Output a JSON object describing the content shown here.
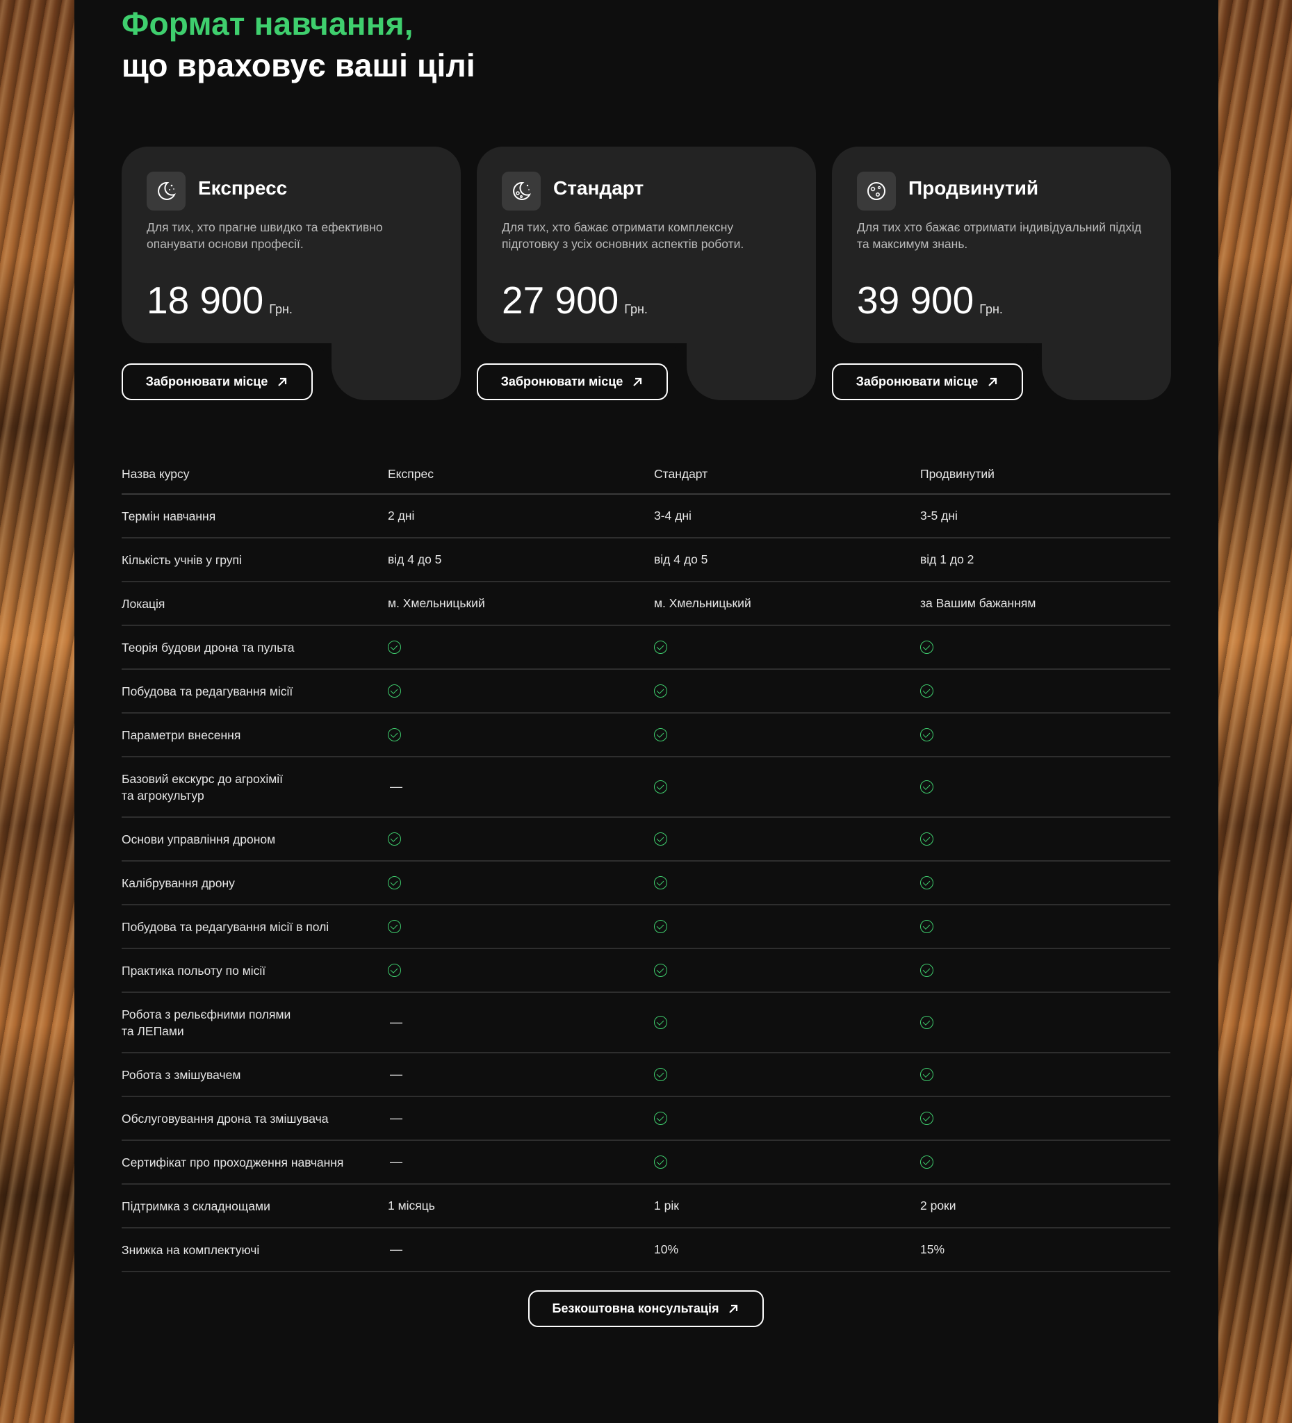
{
  "heading": {
    "line1": "Формат навчання,",
    "line2": "що враховує ваші цілі"
  },
  "colors": {
    "accent": "#3fcf6e",
    "panel": "#0e0e0e",
    "card": "#232323"
  },
  "plans": [
    {
      "icon": "moon-stars-icon",
      "title": "Експресс",
      "desc": "Для тих, хто прагне швидко та ефективно опанувати основи професії.",
      "price": "18 900",
      "currency": "Грн.",
      "button": "Забронювати місце"
    },
    {
      "icon": "moon-crater-icon",
      "title": "Стандарт",
      "desc": "Для тих, хто бажає отримати комплексну підготовку з усіх основних аспектів роботи.",
      "price": "27 900",
      "currency": "Грн.",
      "button": "Забронювати місце"
    },
    {
      "icon": "planet-icon",
      "title": "Продвинутий",
      "desc": "Для тих хто бажає отримати індивідуальний підхід та максимум знань.",
      "price": "39 900",
      "currency": "Грн.",
      "button": "Забронювати місце"
    }
  ],
  "table": {
    "headers": [
      "Назва курсу",
      "Експрес",
      "Стандарт",
      "Продвинутий"
    ],
    "rows": [
      {
        "label": "Термін навчання",
        "values": [
          "2 дні",
          "3-4 дні",
          "3-5 дні"
        ]
      },
      {
        "label": "Кількість учнів у групі",
        "values": [
          "від 4 до 5",
          "від 4 до 5",
          "від 1 до 2"
        ]
      },
      {
        "label": "Локація",
        "values": [
          "м. Хмельницький",
          "м. Хмельницький",
          "за Вашим бажанням"
        ]
      },
      {
        "label": "Теорія будови дрона та пульта",
        "values": [
          "check",
          "check",
          "check"
        ]
      },
      {
        "label": "Побудова та редагування місії",
        "values": [
          "check",
          "check",
          "check"
        ]
      },
      {
        "label": "Параметри внесення",
        "values": [
          "check",
          "check",
          "check"
        ]
      },
      {
        "label": "Базовий екскурс до агрохімії\nта агрокультур",
        "values": [
          "—",
          "check",
          "check"
        ]
      },
      {
        "label": "Основи управління дроном",
        "values": [
          "check",
          "check",
          "check"
        ]
      },
      {
        "label": "Калібрування дрону",
        "values": [
          "check",
          "check",
          "check"
        ]
      },
      {
        "label": "Побудова та редагування місії в полі",
        "values": [
          "check",
          "check",
          "check"
        ]
      },
      {
        "label": "Практика польоту по місії",
        "values": [
          "check",
          "check",
          "check"
        ]
      },
      {
        "label": "Робота з рельєфними полями\nта ЛЕПами",
        "values": [
          "—",
          "check",
          "check"
        ]
      },
      {
        "label": "Робота з змішувачем",
        "values": [
          "—",
          "check",
          "check"
        ]
      },
      {
        "label": "Обслуговування дрона та змішувача",
        "values": [
          "—",
          "check",
          "check"
        ]
      },
      {
        "label": "Сертифікат про проходження навчання",
        "values": [
          "—",
          "check",
          "check"
        ]
      },
      {
        "label": "Підтримка з складнощами",
        "values": [
          "1 місяць",
          "1 рік",
          "2 роки"
        ]
      },
      {
        "label": "Знижка на комплектуючі",
        "values": [
          "—",
          "10%",
          "15%"
        ]
      }
    ]
  },
  "cta": {
    "label": "Безкоштовна консультація"
  }
}
